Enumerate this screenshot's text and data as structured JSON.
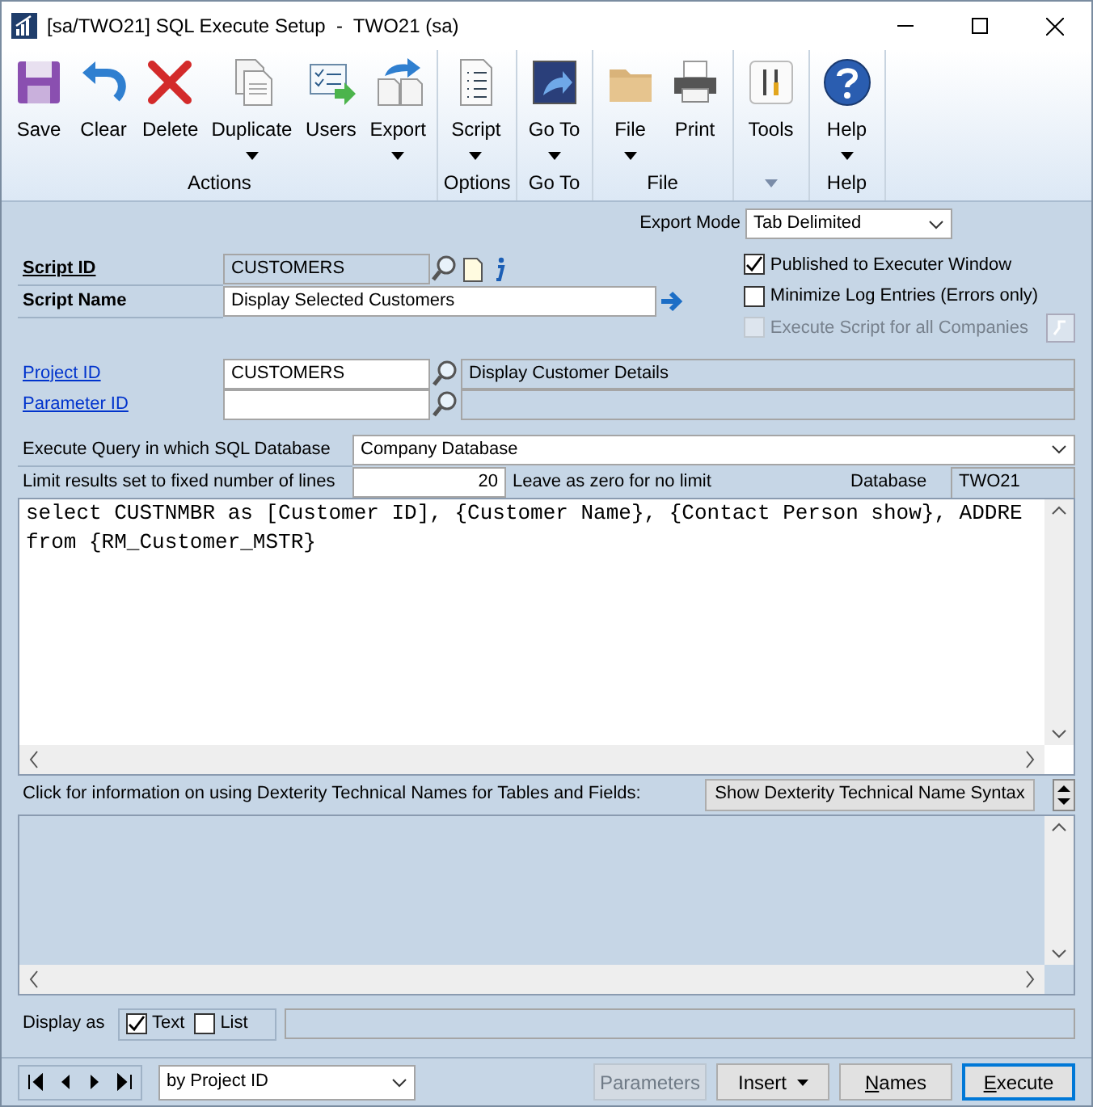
{
  "window": {
    "title": "[sa/TWO21] SQL Execute Setup  -  TWO21 (sa)"
  },
  "ribbon": {
    "groups": [
      {
        "label": "Actions",
        "buttons": [
          {
            "label": "Save",
            "dropdown": false
          },
          {
            "label": "Clear",
            "dropdown": false
          },
          {
            "label": "Delete",
            "dropdown": false
          },
          {
            "label": "Duplicate",
            "dropdown": true
          },
          {
            "label": "Users",
            "dropdown": false
          },
          {
            "label": "Export",
            "dropdown": true
          }
        ]
      },
      {
        "label": "Options",
        "buttons": [
          {
            "label": "Script",
            "dropdown": true
          }
        ]
      },
      {
        "label": "Go To",
        "buttons": [
          {
            "label": "Go To",
            "dropdown": true
          }
        ]
      },
      {
        "label": "File",
        "buttons": [
          {
            "label": "File",
            "dropdown": true
          },
          {
            "label": "Print",
            "dropdown": false
          }
        ]
      },
      {
        "launcher": true,
        "buttons": [
          {
            "label": "Tools",
            "dropdown": false
          }
        ]
      },
      {
        "label": "Help",
        "buttons": [
          {
            "label": "Help",
            "dropdown": true
          }
        ]
      }
    ]
  },
  "export_mode": {
    "label": "Export Mode",
    "value": "Tab Delimited"
  },
  "script_id": {
    "label": "Script ID",
    "value": "CUSTOMERS"
  },
  "script_name": {
    "label": "Script Name",
    "value": "Display Selected Customers"
  },
  "options": [
    {
      "label": "Published to Executer Window",
      "checked": true,
      "disabled": false
    },
    {
      "label": "Minimize Log Entries (Errors only)",
      "checked": false,
      "disabled": false
    },
    {
      "label": "Execute Script for all Companies",
      "checked": false,
      "disabled": true
    }
  ],
  "project_id": {
    "label": "Project ID",
    "value": "CUSTOMERS",
    "description": "Display Customer Details"
  },
  "parameter_id": {
    "label": "Parameter ID"
  },
  "query_database": {
    "label": "Execute Query in which SQL Database",
    "value": "Company Database"
  },
  "limit": {
    "label": "Limit results set to fixed number of lines",
    "value": "20",
    "hint": "Leave as zero for no limit"
  },
  "database": {
    "label": "Database",
    "value": "TWO21"
  },
  "script_lines": [
    "select CUSTNMBR as [Customer ID], {Customer Name}, {Contact Person show}, ADDRE",
    "from {RM_Customer_MSTR}"
  ],
  "help_text": "Click for information on using Dexterity Technical Names for Tables and Fields:",
  "syntax_button": "Show Dexterity Technical Name Syntax",
  "display_as": {
    "label": "Display as",
    "options": [
      {
        "label": "Text",
        "checked": true
      },
      {
        "label": "List",
        "checked": false
      }
    ]
  },
  "browse_by": "by Project ID",
  "buttons": [
    {
      "label": "Parameters",
      "disabled": true,
      "dropdown": false,
      "default": false
    },
    {
      "label": "Insert",
      "disabled": false,
      "dropdown": true,
      "default": false
    },
    {
      "label": "Names",
      "disabled": false,
      "dropdown": false,
      "default": false
    },
    {
      "label": "Execute",
      "disabled": false,
      "dropdown": false,
      "default": true
    }
  ]
}
